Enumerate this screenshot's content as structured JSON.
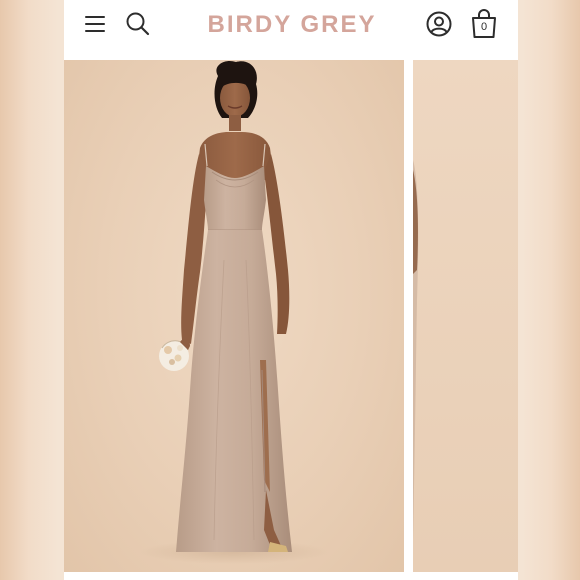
{
  "header": {
    "brand": "BIRDY GREY",
    "menu_icon": "hamburger-menu-icon",
    "search_icon": "search-icon",
    "account_icon": "user-account-icon",
    "bag_icon": "shopping-bag-icon",
    "bag_count": "0",
    "brand_color": "#d4a59b"
  },
  "gallery": {
    "current_slide": 1,
    "backdrop_color": "#e9cfb6",
    "dress_color": "#c8ad9a"
  }
}
